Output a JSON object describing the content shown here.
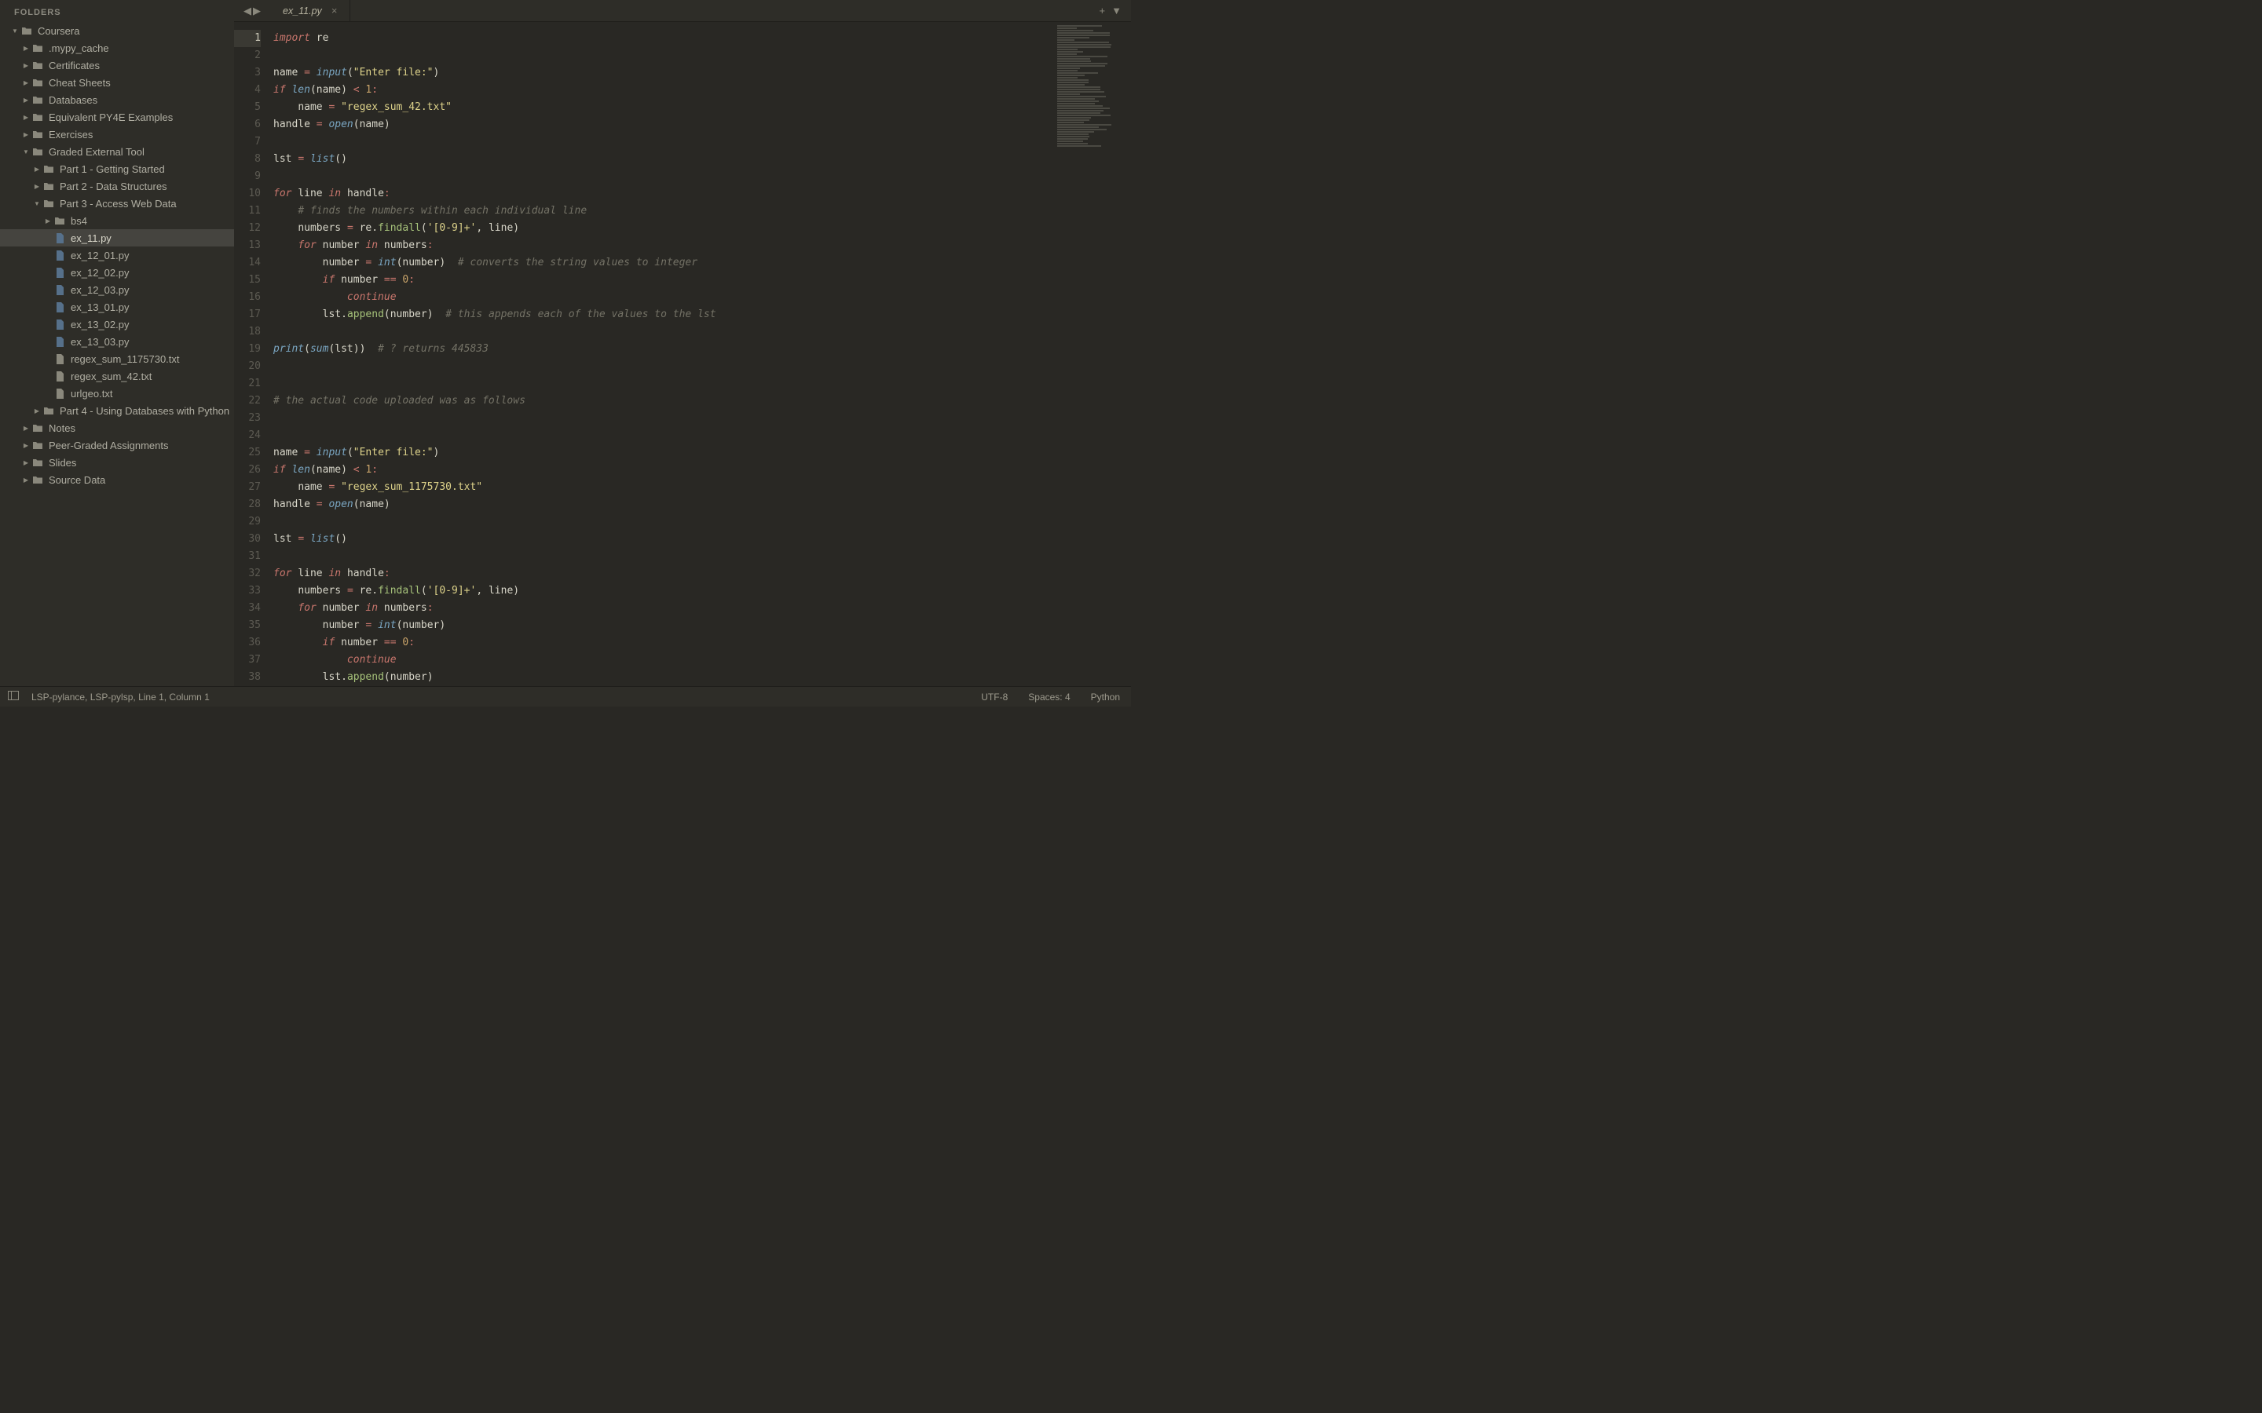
{
  "sidebar": {
    "title": "FOLDERS",
    "tree": [
      {
        "d": 0,
        "open": true,
        "kind": "folder",
        "name": "Coursera"
      },
      {
        "d": 1,
        "open": false,
        "kind": "folder",
        "name": ".mypy_cache"
      },
      {
        "d": 1,
        "open": false,
        "kind": "folder",
        "name": "Certificates"
      },
      {
        "d": 1,
        "open": false,
        "kind": "folder",
        "name": "Cheat Sheets"
      },
      {
        "d": 1,
        "open": false,
        "kind": "folder",
        "name": "Databases"
      },
      {
        "d": 1,
        "open": false,
        "kind": "folder",
        "name": "Equivalent PY4E Examples"
      },
      {
        "d": 1,
        "open": false,
        "kind": "folder",
        "name": "Exercises"
      },
      {
        "d": 1,
        "open": true,
        "kind": "folder",
        "name": "Graded External Tool"
      },
      {
        "d": 2,
        "open": false,
        "kind": "folder",
        "name": "Part 1 - Getting Started"
      },
      {
        "d": 2,
        "open": false,
        "kind": "folder",
        "name": "Part 2 - Data Structures"
      },
      {
        "d": 2,
        "open": true,
        "kind": "folder",
        "name": "Part 3 - Access Web Data"
      },
      {
        "d": 3,
        "open": false,
        "kind": "folder",
        "name": "bs4"
      },
      {
        "d": 3,
        "kind": "py",
        "name": "ex_11.py",
        "selected": true
      },
      {
        "d": 3,
        "kind": "py",
        "name": "ex_12_01.py"
      },
      {
        "d": 3,
        "kind": "py",
        "name": "ex_12_02.py"
      },
      {
        "d": 3,
        "kind": "py",
        "name": "ex_12_03.py"
      },
      {
        "d": 3,
        "kind": "py",
        "name": "ex_13_01.py"
      },
      {
        "d": 3,
        "kind": "py",
        "name": "ex_13_02.py"
      },
      {
        "d": 3,
        "kind": "py",
        "name": "ex_13_03.py"
      },
      {
        "d": 3,
        "kind": "txt",
        "name": "regex_sum_1175730.txt"
      },
      {
        "d": 3,
        "kind": "txt",
        "name": "regex_sum_42.txt"
      },
      {
        "d": 3,
        "kind": "txt",
        "name": "urlgeo.txt"
      },
      {
        "d": 2,
        "open": false,
        "kind": "folder",
        "name": "Part 4 - Using Databases with Python"
      },
      {
        "d": 1,
        "open": false,
        "kind": "folder",
        "name": "Notes"
      },
      {
        "d": 1,
        "open": false,
        "kind": "folder",
        "name": "Peer-Graded Assignments"
      },
      {
        "d": 1,
        "open": false,
        "kind": "folder",
        "name": "Slides"
      },
      {
        "d": 1,
        "open": false,
        "kind": "folder",
        "name": "Source Data"
      }
    ]
  },
  "tabs": {
    "active_name": "ex_11.py"
  },
  "code": {
    "current_line": 1,
    "lines": [
      [
        [
          "kw",
          "import"
        ],
        [
          "sp",
          " "
        ],
        [
          "mod",
          "re"
        ]
      ],
      [],
      [
        [
          "var",
          "name"
        ],
        [
          "sp",
          " "
        ],
        [
          "op",
          "="
        ],
        [
          "sp",
          " "
        ],
        [
          "bi",
          "input"
        ],
        [
          "var",
          "("
        ],
        [
          "str",
          "\"Enter file:\""
        ],
        [
          "var",
          ")"
        ]
      ],
      [
        [
          "kw",
          "if"
        ],
        [
          "sp",
          " "
        ],
        [
          "bi",
          "len"
        ],
        [
          "var",
          "(name)"
        ],
        [
          "sp",
          " "
        ],
        [
          "op",
          "<"
        ],
        [
          "sp",
          " "
        ],
        [
          "num",
          "1"
        ],
        [
          "op",
          ":"
        ]
      ],
      [
        [
          "sp",
          "    "
        ],
        [
          "var",
          "name"
        ],
        [
          "sp",
          " "
        ],
        [
          "op",
          "="
        ],
        [
          "sp",
          " "
        ],
        [
          "str",
          "\"regex_sum_42.txt\""
        ]
      ],
      [
        [
          "var",
          "handle"
        ],
        [
          "sp",
          " "
        ],
        [
          "op",
          "="
        ],
        [
          "sp",
          " "
        ],
        [
          "bi",
          "open"
        ],
        [
          "var",
          "(name)"
        ]
      ],
      [],
      [
        [
          "var",
          "lst"
        ],
        [
          "sp",
          " "
        ],
        [
          "op",
          "="
        ],
        [
          "sp",
          " "
        ],
        [
          "bi",
          "list"
        ],
        [
          "var",
          "()"
        ]
      ],
      [],
      [
        [
          "kw",
          "for"
        ],
        [
          "sp",
          " "
        ],
        [
          "var",
          "line"
        ],
        [
          "sp",
          " "
        ],
        [
          "kw",
          "in"
        ],
        [
          "sp",
          " "
        ],
        [
          "var",
          "handle"
        ],
        [
          "op",
          ":"
        ]
      ],
      [
        [
          "sp",
          "    "
        ],
        [
          "cm",
          "# finds the numbers within each individual line"
        ]
      ],
      [
        [
          "sp",
          "    "
        ],
        [
          "var",
          "numbers"
        ],
        [
          "sp",
          " "
        ],
        [
          "op",
          "="
        ],
        [
          "sp",
          " "
        ],
        [
          "var",
          "re."
        ],
        [
          "fn",
          "findall"
        ],
        [
          "var",
          "("
        ],
        [
          "str",
          "'[0-9]+'"
        ],
        [
          "var",
          ", line)"
        ]
      ],
      [
        [
          "sp",
          "    "
        ],
        [
          "kw",
          "for"
        ],
        [
          "sp",
          " "
        ],
        [
          "var",
          "number"
        ],
        [
          "sp",
          " "
        ],
        [
          "kw",
          "in"
        ],
        [
          "sp",
          " "
        ],
        [
          "var",
          "numbers"
        ],
        [
          "op",
          ":"
        ]
      ],
      [
        [
          "sp",
          "        "
        ],
        [
          "var",
          "number"
        ],
        [
          "sp",
          " "
        ],
        [
          "op",
          "="
        ],
        [
          "sp",
          " "
        ],
        [
          "bi",
          "int"
        ],
        [
          "var",
          "(number)"
        ],
        [
          "sp",
          "  "
        ],
        [
          "cm",
          "# converts the string values to integer"
        ]
      ],
      [
        [
          "sp",
          "        "
        ],
        [
          "kw",
          "if"
        ],
        [
          "sp",
          " "
        ],
        [
          "var",
          "number"
        ],
        [
          "sp",
          " "
        ],
        [
          "op",
          "=="
        ],
        [
          "sp",
          " "
        ],
        [
          "num",
          "0"
        ],
        [
          "op",
          ":"
        ]
      ],
      [
        [
          "sp",
          "            "
        ],
        [
          "kw",
          "continue"
        ]
      ],
      [
        [
          "sp",
          "        "
        ],
        [
          "var",
          "lst."
        ],
        [
          "fn",
          "append"
        ],
        [
          "var",
          "(number)"
        ],
        [
          "sp",
          "  "
        ],
        [
          "cm",
          "# this appends each of the values to the lst"
        ]
      ],
      [],
      [
        [
          "bi",
          "print"
        ],
        [
          "var",
          "("
        ],
        [
          "bi",
          "sum"
        ],
        [
          "var",
          "(lst))"
        ],
        [
          "sp",
          "  "
        ],
        [
          "cm",
          "# ? returns 445833"
        ]
      ],
      [],
      [],
      [
        [
          "cm",
          "# the actual code uploaded was as follows"
        ]
      ],
      [],
      [],
      [
        [
          "var",
          "name"
        ],
        [
          "sp",
          " "
        ],
        [
          "op",
          "="
        ],
        [
          "sp",
          " "
        ],
        [
          "bi",
          "input"
        ],
        [
          "var",
          "("
        ],
        [
          "str",
          "\"Enter file:\""
        ],
        [
          "var",
          ")"
        ]
      ],
      [
        [
          "kw",
          "if"
        ],
        [
          "sp",
          " "
        ],
        [
          "bi",
          "len"
        ],
        [
          "var",
          "(name)"
        ],
        [
          "sp",
          " "
        ],
        [
          "op",
          "<"
        ],
        [
          "sp",
          " "
        ],
        [
          "num",
          "1"
        ],
        [
          "op",
          ":"
        ]
      ],
      [
        [
          "sp",
          "    "
        ],
        [
          "var",
          "name"
        ],
        [
          "sp",
          " "
        ],
        [
          "op",
          "="
        ],
        [
          "sp",
          " "
        ],
        [
          "str",
          "\"regex_sum_1175730.txt\""
        ]
      ],
      [
        [
          "var",
          "handle"
        ],
        [
          "sp",
          " "
        ],
        [
          "op",
          "="
        ],
        [
          "sp",
          " "
        ],
        [
          "bi",
          "open"
        ],
        [
          "var",
          "(name)"
        ]
      ],
      [],
      [
        [
          "var",
          "lst"
        ],
        [
          "sp",
          " "
        ],
        [
          "op",
          "="
        ],
        [
          "sp",
          " "
        ],
        [
          "bi",
          "list"
        ],
        [
          "var",
          "()"
        ]
      ],
      [],
      [
        [
          "kw",
          "for"
        ],
        [
          "sp",
          " "
        ],
        [
          "var",
          "line"
        ],
        [
          "sp",
          " "
        ],
        [
          "kw",
          "in"
        ],
        [
          "sp",
          " "
        ],
        [
          "var",
          "handle"
        ],
        [
          "op",
          ":"
        ]
      ],
      [
        [
          "sp",
          "    "
        ],
        [
          "var",
          "numbers"
        ],
        [
          "sp",
          " "
        ],
        [
          "op",
          "="
        ],
        [
          "sp",
          " "
        ],
        [
          "var",
          "re."
        ],
        [
          "fn",
          "findall"
        ],
        [
          "var",
          "("
        ],
        [
          "str",
          "'[0-9]+'"
        ],
        [
          "var",
          ", line)"
        ]
      ],
      [
        [
          "sp",
          "    "
        ],
        [
          "kw",
          "for"
        ],
        [
          "sp",
          " "
        ],
        [
          "var",
          "number"
        ],
        [
          "sp",
          " "
        ],
        [
          "kw",
          "in"
        ],
        [
          "sp",
          " "
        ],
        [
          "var",
          "numbers"
        ],
        [
          "op",
          ":"
        ]
      ],
      [
        [
          "sp",
          "        "
        ],
        [
          "var",
          "number"
        ],
        [
          "sp",
          " "
        ],
        [
          "op",
          "="
        ],
        [
          "sp",
          " "
        ],
        [
          "bi",
          "int"
        ],
        [
          "var",
          "(number)"
        ]
      ],
      [
        [
          "sp",
          "        "
        ],
        [
          "kw",
          "if"
        ],
        [
          "sp",
          " "
        ],
        [
          "var",
          "number"
        ],
        [
          "sp",
          " "
        ],
        [
          "op",
          "=="
        ],
        [
          "sp",
          " "
        ],
        [
          "num",
          "0"
        ],
        [
          "op",
          ":"
        ]
      ],
      [
        [
          "sp",
          "            "
        ],
        [
          "kw",
          "continue"
        ]
      ],
      [
        [
          "sp",
          "        "
        ],
        [
          "var",
          "lst."
        ],
        [
          "fn",
          "append"
        ],
        [
          "var",
          "(number)"
        ]
      ]
    ]
  },
  "status": {
    "left": "LSP-pylance, LSP-pylsp, Line 1, Column 1",
    "encoding": "UTF-8",
    "indent": "Spaces: 4",
    "lang": "Python"
  },
  "minimap_lines": 52
}
